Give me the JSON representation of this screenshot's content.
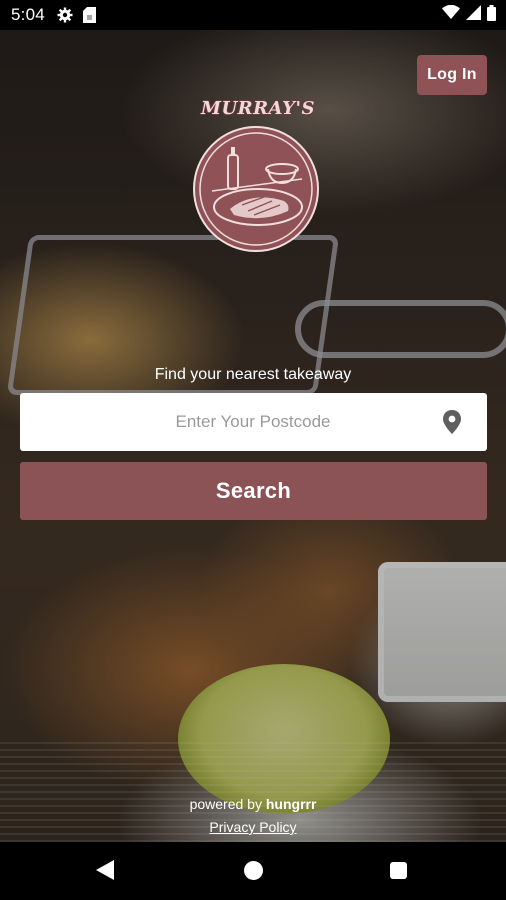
{
  "status_bar": {
    "time": "5:04",
    "left_icons": [
      "settings-icon",
      "sim-card-icon"
    ],
    "right_icons": [
      "wifi-icon",
      "signal-icon",
      "battery-icon"
    ]
  },
  "header": {
    "login_label": "Log In"
  },
  "brand": {
    "name": "MURRAY'S",
    "logo_icon": "fish-and-chips-logo-icon",
    "accent_color": "#8c5357"
  },
  "search": {
    "tagline": "Find your nearest takeaway",
    "postcode_placeholder": "Enter Your Postcode",
    "postcode_value": "",
    "location_icon": "location-pin-icon",
    "button_label": "Search"
  },
  "footer": {
    "powered_prefix": "powered by",
    "powered_brand": "hungrrr",
    "privacy_label": "Privacy Policy"
  },
  "nav_bar": {
    "icons": [
      "back-icon",
      "home-icon",
      "recents-icon"
    ]
  }
}
